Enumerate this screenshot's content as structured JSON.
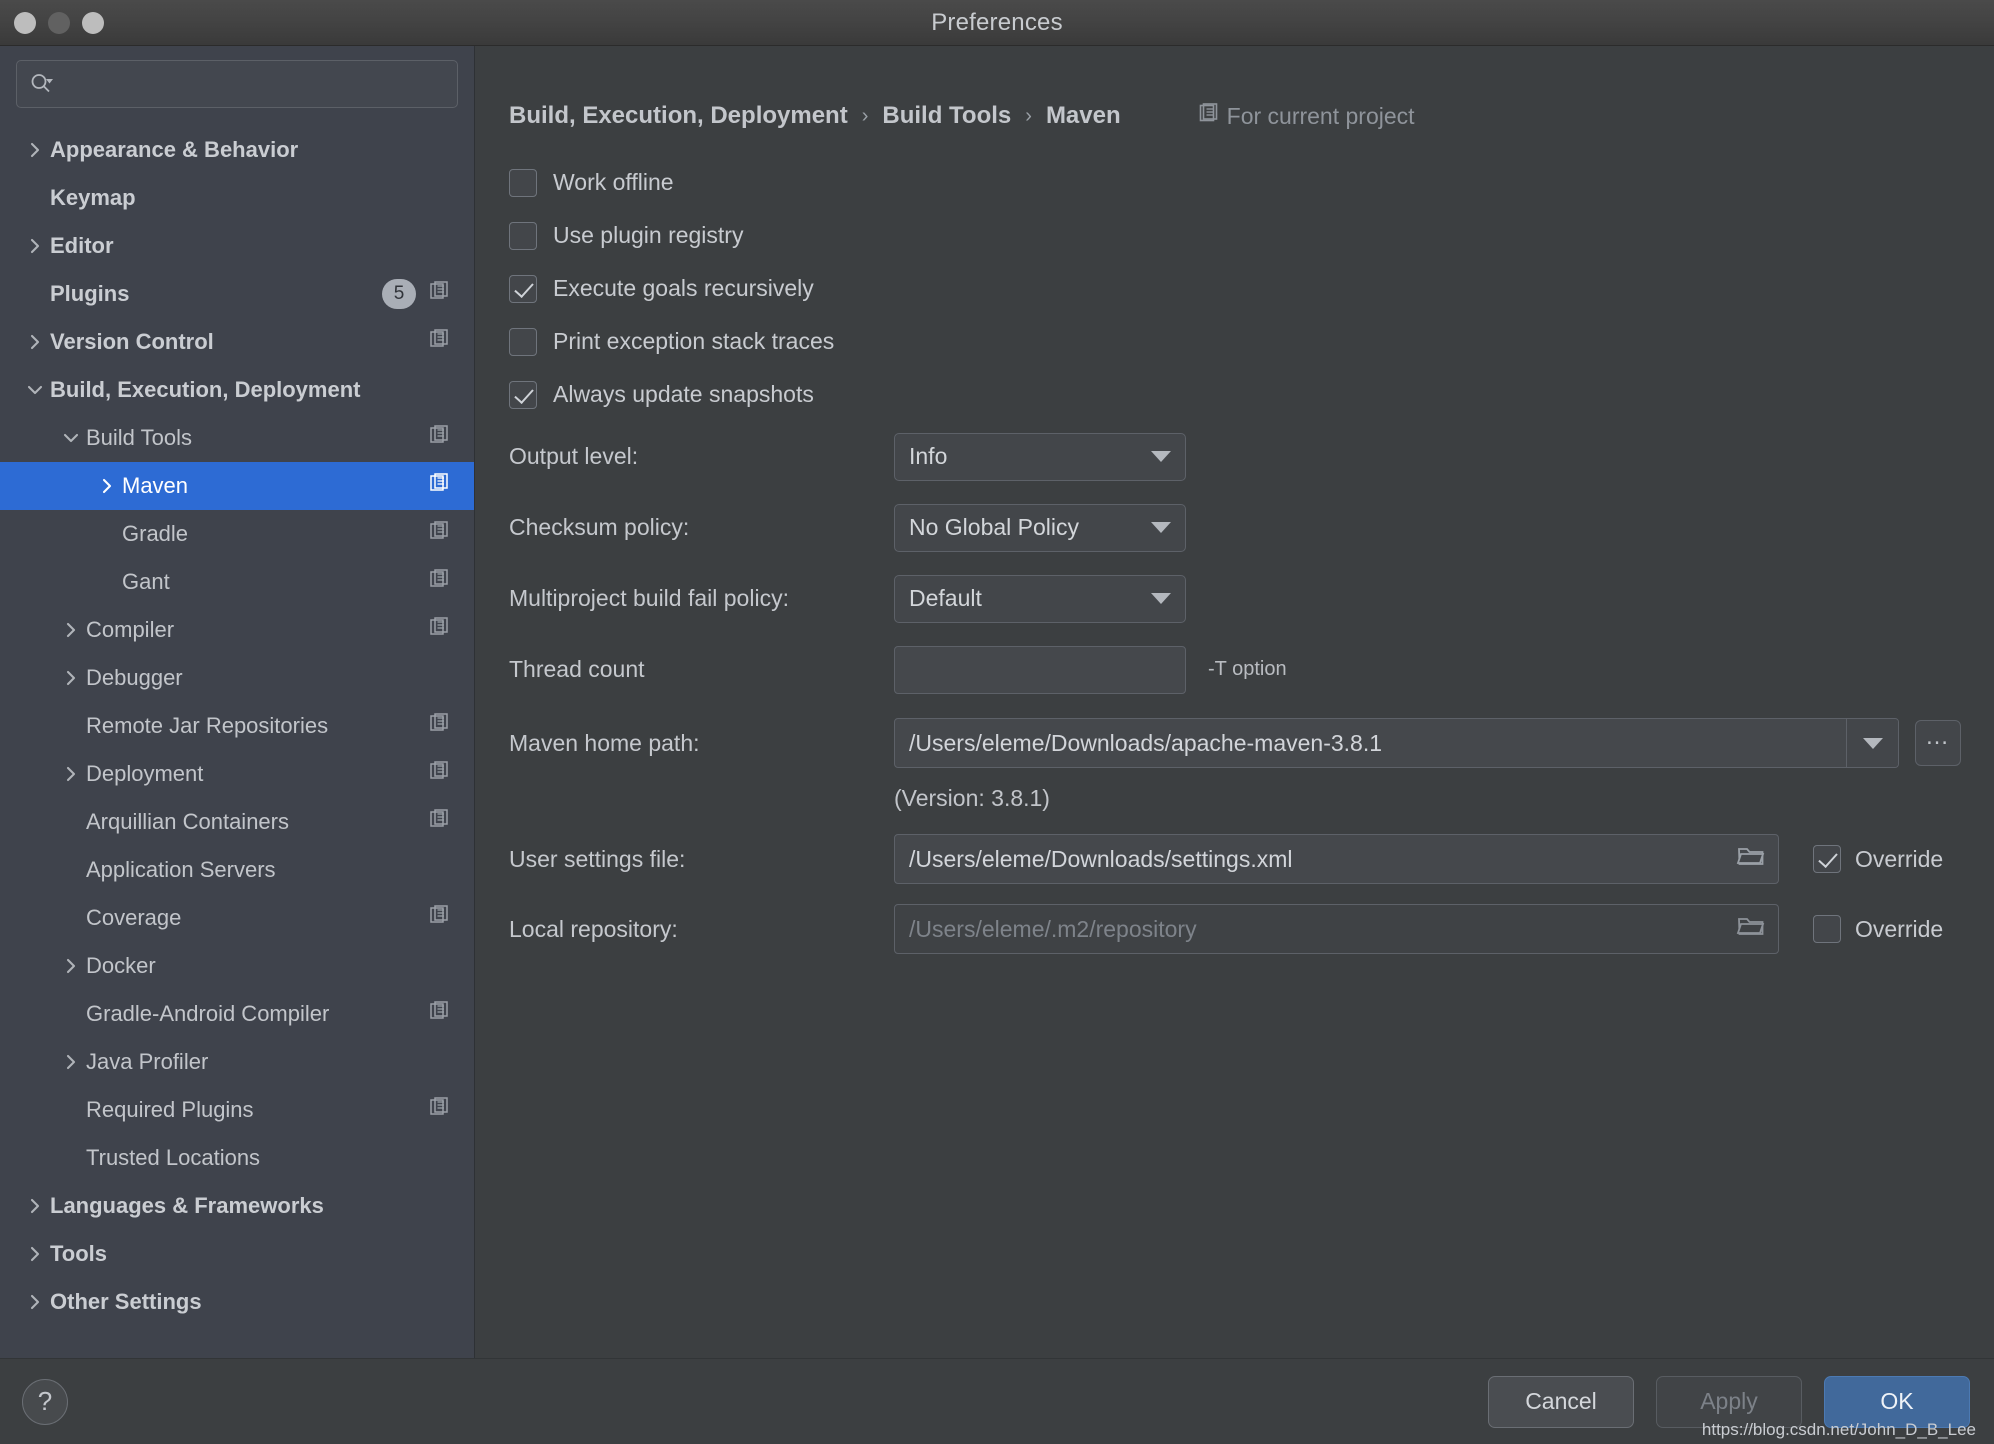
{
  "window": {
    "title": "Preferences",
    "traffic_lights": [
      "close",
      "minimize",
      "zoom"
    ]
  },
  "search": {
    "value": "",
    "placeholder": "",
    "icon": "search-icon"
  },
  "sidebar": {
    "items": [
      {
        "label": "Appearance & Behavior",
        "arrow": "collapsed",
        "indent": 0,
        "bold": true,
        "copy": false,
        "badge": null,
        "selected": false
      },
      {
        "label": "Keymap",
        "arrow": "none",
        "indent": 0,
        "bold": true,
        "copy": false,
        "badge": null,
        "selected": false
      },
      {
        "label": "Editor",
        "arrow": "collapsed",
        "indent": 0,
        "bold": true,
        "copy": false,
        "badge": null,
        "selected": false
      },
      {
        "label": "Plugins",
        "arrow": "none",
        "indent": 0,
        "bold": true,
        "copy": true,
        "badge": "5",
        "selected": false
      },
      {
        "label": "Version Control",
        "arrow": "collapsed",
        "indent": 0,
        "bold": true,
        "copy": true,
        "badge": null,
        "selected": false
      },
      {
        "label": "Build, Execution, Deployment",
        "arrow": "expanded",
        "indent": 0,
        "bold": true,
        "copy": false,
        "badge": null,
        "selected": false
      },
      {
        "label": "Build Tools",
        "arrow": "expanded",
        "indent": 1,
        "bold": false,
        "copy": true,
        "badge": null,
        "selected": false
      },
      {
        "label": "Maven",
        "arrow": "collapsed",
        "indent": 2,
        "bold": false,
        "copy": true,
        "badge": null,
        "selected": true
      },
      {
        "label": "Gradle",
        "arrow": "none",
        "indent": 2,
        "bold": false,
        "copy": true,
        "badge": null,
        "selected": false
      },
      {
        "label": "Gant",
        "arrow": "none",
        "indent": 2,
        "bold": false,
        "copy": true,
        "badge": null,
        "selected": false
      },
      {
        "label": "Compiler",
        "arrow": "collapsed",
        "indent": 1,
        "bold": false,
        "copy": true,
        "badge": null,
        "selected": false
      },
      {
        "label": "Debugger",
        "arrow": "collapsed",
        "indent": 1,
        "bold": false,
        "copy": false,
        "badge": null,
        "selected": false
      },
      {
        "label": "Remote Jar Repositories",
        "arrow": "none",
        "indent": 1,
        "bold": false,
        "copy": true,
        "badge": null,
        "selected": false
      },
      {
        "label": "Deployment",
        "arrow": "collapsed",
        "indent": 1,
        "bold": false,
        "copy": true,
        "badge": null,
        "selected": false
      },
      {
        "label": "Arquillian Containers",
        "arrow": "none",
        "indent": 1,
        "bold": false,
        "copy": true,
        "badge": null,
        "selected": false
      },
      {
        "label": "Application Servers",
        "arrow": "none",
        "indent": 1,
        "bold": false,
        "copy": false,
        "badge": null,
        "selected": false
      },
      {
        "label": "Coverage",
        "arrow": "none",
        "indent": 1,
        "bold": false,
        "copy": true,
        "badge": null,
        "selected": false
      },
      {
        "label": "Docker",
        "arrow": "collapsed",
        "indent": 1,
        "bold": false,
        "copy": false,
        "badge": null,
        "selected": false
      },
      {
        "label": "Gradle-Android Compiler",
        "arrow": "none",
        "indent": 1,
        "bold": false,
        "copy": true,
        "badge": null,
        "selected": false
      },
      {
        "label": "Java Profiler",
        "arrow": "collapsed",
        "indent": 1,
        "bold": false,
        "copy": false,
        "badge": null,
        "selected": false
      },
      {
        "label": "Required Plugins",
        "arrow": "none",
        "indent": 1,
        "bold": false,
        "copy": true,
        "badge": null,
        "selected": false
      },
      {
        "label": "Trusted Locations",
        "arrow": "none",
        "indent": 1,
        "bold": false,
        "copy": false,
        "badge": null,
        "selected": false
      },
      {
        "label": "Languages & Frameworks",
        "arrow": "collapsed",
        "indent": 0,
        "bold": true,
        "copy": false,
        "badge": null,
        "selected": false
      },
      {
        "label": "Tools",
        "arrow": "collapsed",
        "indent": 0,
        "bold": true,
        "copy": false,
        "badge": null,
        "selected": false
      },
      {
        "label": "Other Settings",
        "arrow": "collapsed",
        "indent": 0,
        "bold": true,
        "copy": false,
        "badge": null,
        "selected": false
      }
    ]
  },
  "main": {
    "breadcrumb": {
      "segments": [
        "Build, Execution, Deployment",
        "Build Tools",
        "Maven"
      ],
      "separator": "›",
      "scope_label": "For current project",
      "scope_icon": "project-scope-icon"
    },
    "checkboxes": [
      {
        "label": "Work offline",
        "checked": false
      },
      {
        "label": "Use plugin registry",
        "checked": false
      },
      {
        "label": "Execute goals recursively",
        "checked": true
      },
      {
        "label": "Print exception stack traces",
        "checked": false
      },
      {
        "label": "Always update snapshots",
        "checked": true
      }
    ],
    "output_level": {
      "label": "Output level:",
      "value": "Info"
    },
    "checksum_policy": {
      "label": "Checksum policy:",
      "value": "No Global Policy"
    },
    "multiproject_policy": {
      "label": "Multiproject build fail policy:",
      "value": "Default"
    },
    "thread_count": {
      "label": "Thread count",
      "value": "",
      "hint": "-T option"
    },
    "maven_home": {
      "label": "Maven home path:",
      "value": "/Users/eleme/Downloads/apache-maven-3.8.1",
      "browse_label": "…",
      "version_note": "(Version: 3.8.1)"
    },
    "user_settings": {
      "label": "User settings file:",
      "value": "/Users/eleme/Downloads/settings.xml",
      "override_label": "Override",
      "override_checked": true,
      "disabled": false
    },
    "local_repository": {
      "label": "Local repository:",
      "value": "/Users/eleme/.m2/repository",
      "override_label": "Override",
      "override_checked": false,
      "disabled": true
    }
  },
  "footer": {
    "help_label": "?",
    "cancel_label": "Cancel",
    "apply_label": "Apply",
    "apply_disabled": true,
    "ok_label": "OK",
    "watermark": "https://blog.csdn.net/John_D_B_Lee"
  },
  "colors": {
    "selection_blue": "#2d6bd4",
    "primary_button": "#41699b",
    "sidebar_bg": "#3f434c",
    "content_bg": "#3c3f41"
  }
}
